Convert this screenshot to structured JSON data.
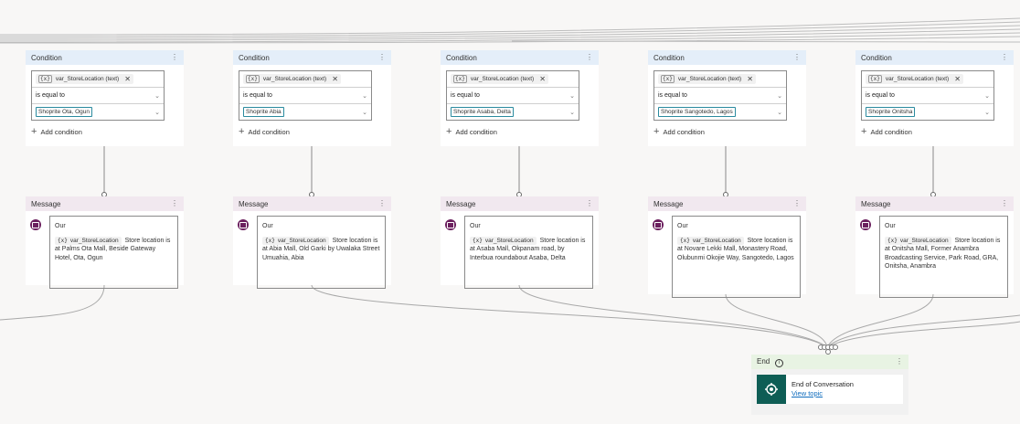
{
  "conditions": [
    {
      "header": "Condition",
      "variable": "var_StoreLocation (text)",
      "operator": "is equal to",
      "value": "Shoprite Ota, Ogun",
      "add_label": "Add condition"
    },
    {
      "header": "Condition",
      "variable": "var_StoreLocation (text)",
      "operator": "is equal to",
      "value": "Shoprite Abia",
      "add_label": "Add condition"
    },
    {
      "header": "Condition",
      "variable": "var_StoreLocation (text)",
      "operator": "is equal to",
      "value": "Shoprite Asaba, Delta",
      "add_label": "Add condition"
    },
    {
      "header": "Condition",
      "variable": "var_StoreLocation (text)",
      "operator": "is equal to",
      "value": "Shoprite Sangotedo, Lagos",
      "add_label": "Add condition"
    },
    {
      "header": "Condition",
      "variable": "var_StoreLocation (text)",
      "operator": "is equal to",
      "value": "Shoprite Onitsha",
      "add_label": "Add condition"
    }
  ],
  "messages": [
    {
      "header": "Message",
      "intro": "Our",
      "variable": "var_StoreLocation",
      "text": "Store location is at Palms Ota Mall, Beside Gateway Hotel, Ota, Ogun"
    },
    {
      "header": "Message",
      "intro": "Our",
      "variable": "var_StoreLocation",
      "text": "Store location is at Abia Mall, Old Garki by Uwalaka Street Umuahia, Abia"
    },
    {
      "header": "Message",
      "intro": "Our",
      "variable": "var_StoreLocation",
      "text": "Store location is at Asaba Mall, Okpanam road, by Interbua roundabout Asaba, Delta"
    },
    {
      "header": "Message",
      "intro": "Our",
      "variable": "var_StoreLocation",
      "text": "Store location is at Novare Lekki Mall, Monastery Road, Olubunmi Okojie Way, Sangotedo, Lagos"
    },
    {
      "header": "Message",
      "intro": "Our",
      "variable": "var_StoreLocation",
      "text": "Store location is at Onitsha Mall, Former Anambra Broadcasting Service, Park Road, GRA, Onitsha, Anambra"
    }
  ],
  "end": {
    "header": "End",
    "title": "End of Conversation",
    "link": "View topic"
  },
  "icons": {
    "variable": "{x}",
    "more": "⋮",
    "remove": "✕",
    "chevron": "⌄",
    "plus": "+",
    "info": "i"
  },
  "colors": {
    "condition_header": "#e4eef9",
    "message_header": "#f1e8ef",
    "end_header": "#e8f3e3",
    "message_icon": "#6b1f5e",
    "end_icon": "#0e5d55",
    "value_chip_border": "#2a8a9e"
  }
}
